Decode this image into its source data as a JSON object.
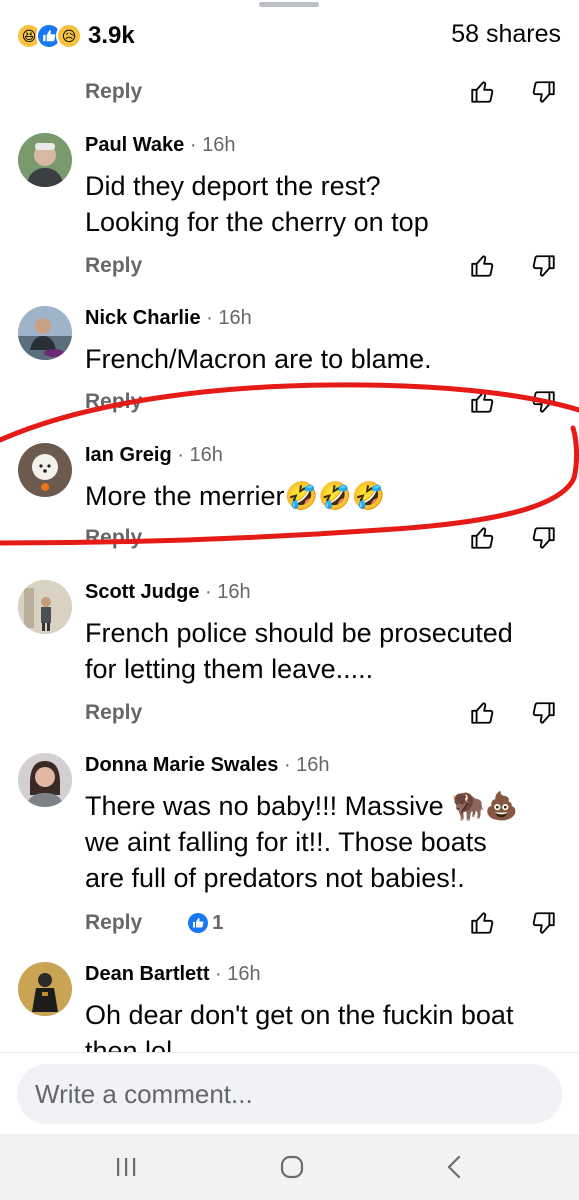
{
  "header": {
    "reaction_icons": [
      "haha-icon",
      "like-icon",
      "sad-icon"
    ],
    "reaction_count": "3.9k",
    "shares": "58 shares"
  },
  "top_reply": {
    "label": "Reply"
  },
  "comments": [
    {
      "author": "Paul Wake",
      "time": "· 16h",
      "lines": [
        "Did they deport the rest?",
        "Looking for the cherry on top"
      ],
      "reply": "Reply"
    },
    {
      "author": "Nick Charlie",
      "time": "· 16h",
      "lines": [
        "French/Macron are to blame."
      ],
      "reply": "Reply"
    },
    {
      "author": "Ian Greig",
      "time": "· 16h",
      "lines": [
        "More the merrier🤣🤣🤣"
      ],
      "reply": "Reply"
    },
    {
      "author": "Scott Judge",
      "time": "· 16h",
      "lines": [
        "French police should be prosecuted",
        "for letting them leave....."
      ],
      "reply": "Reply"
    },
    {
      "author": "Donna Marie Swales",
      "time": "· 16h",
      "lines": [
        "There was no baby!!! Massive 🦬💩",
        "we aint falling for it!!. Those boats",
        "are full of predators not babies!."
      ],
      "reply": "Reply",
      "reaction_count": "1"
    },
    {
      "author": "Dean Bartlett",
      "time": "· 16h",
      "lines": [
        "Oh dear don't get on the fuckin boat",
        "then lol"
      ]
    }
  ],
  "composer": {
    "placeholder": "Write a comment..."
  },
  "nav": {
    "icons": [
      "recent-apps-icon",
      "home-icon",
      "back-icon"
    ]
  },
  "colors": {
    "accent": "#1877f2",
    "text": "#050505",
    "muted": "#65676b",
    "annotation": "#e41b17",
    "input_bg": "#f0f2f5"
  }
}
